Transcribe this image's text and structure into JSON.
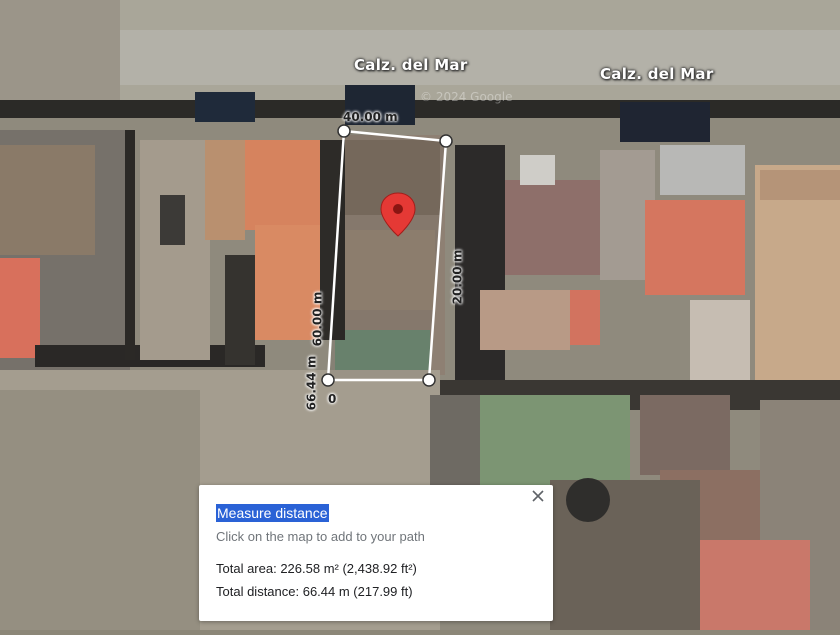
{
  "map": {
    "street_labels": [
      "Calz. del Mar",
      "Calz. del Mar"
    ],
    "watermark": "© 2024 Google",
    "pin_color": "#e53935",
    "measure_line_color": "#ffffff",
    "measure_fill_color": "rgba(0,0,0,0.08)"
  },
  "measurements": {
    "top_edge": "40.00 m",
    "right_edge": "20.00 m",
    "left_edge_upper": "60.00 m",
    "left_edge_lower": "66.44 m",
    "start": "0"
  },
  "panel": {
    "title": "Measure distance",
    "subtitle": "Click on the map to add to your path",
    "total_area": "Total area: 226.58 m² (2,438.92 ft²)",
    "total_distance": "Total distance: 66.44 m (217.99 ft)",
    "close_icon": "close-icon"
  }
}
